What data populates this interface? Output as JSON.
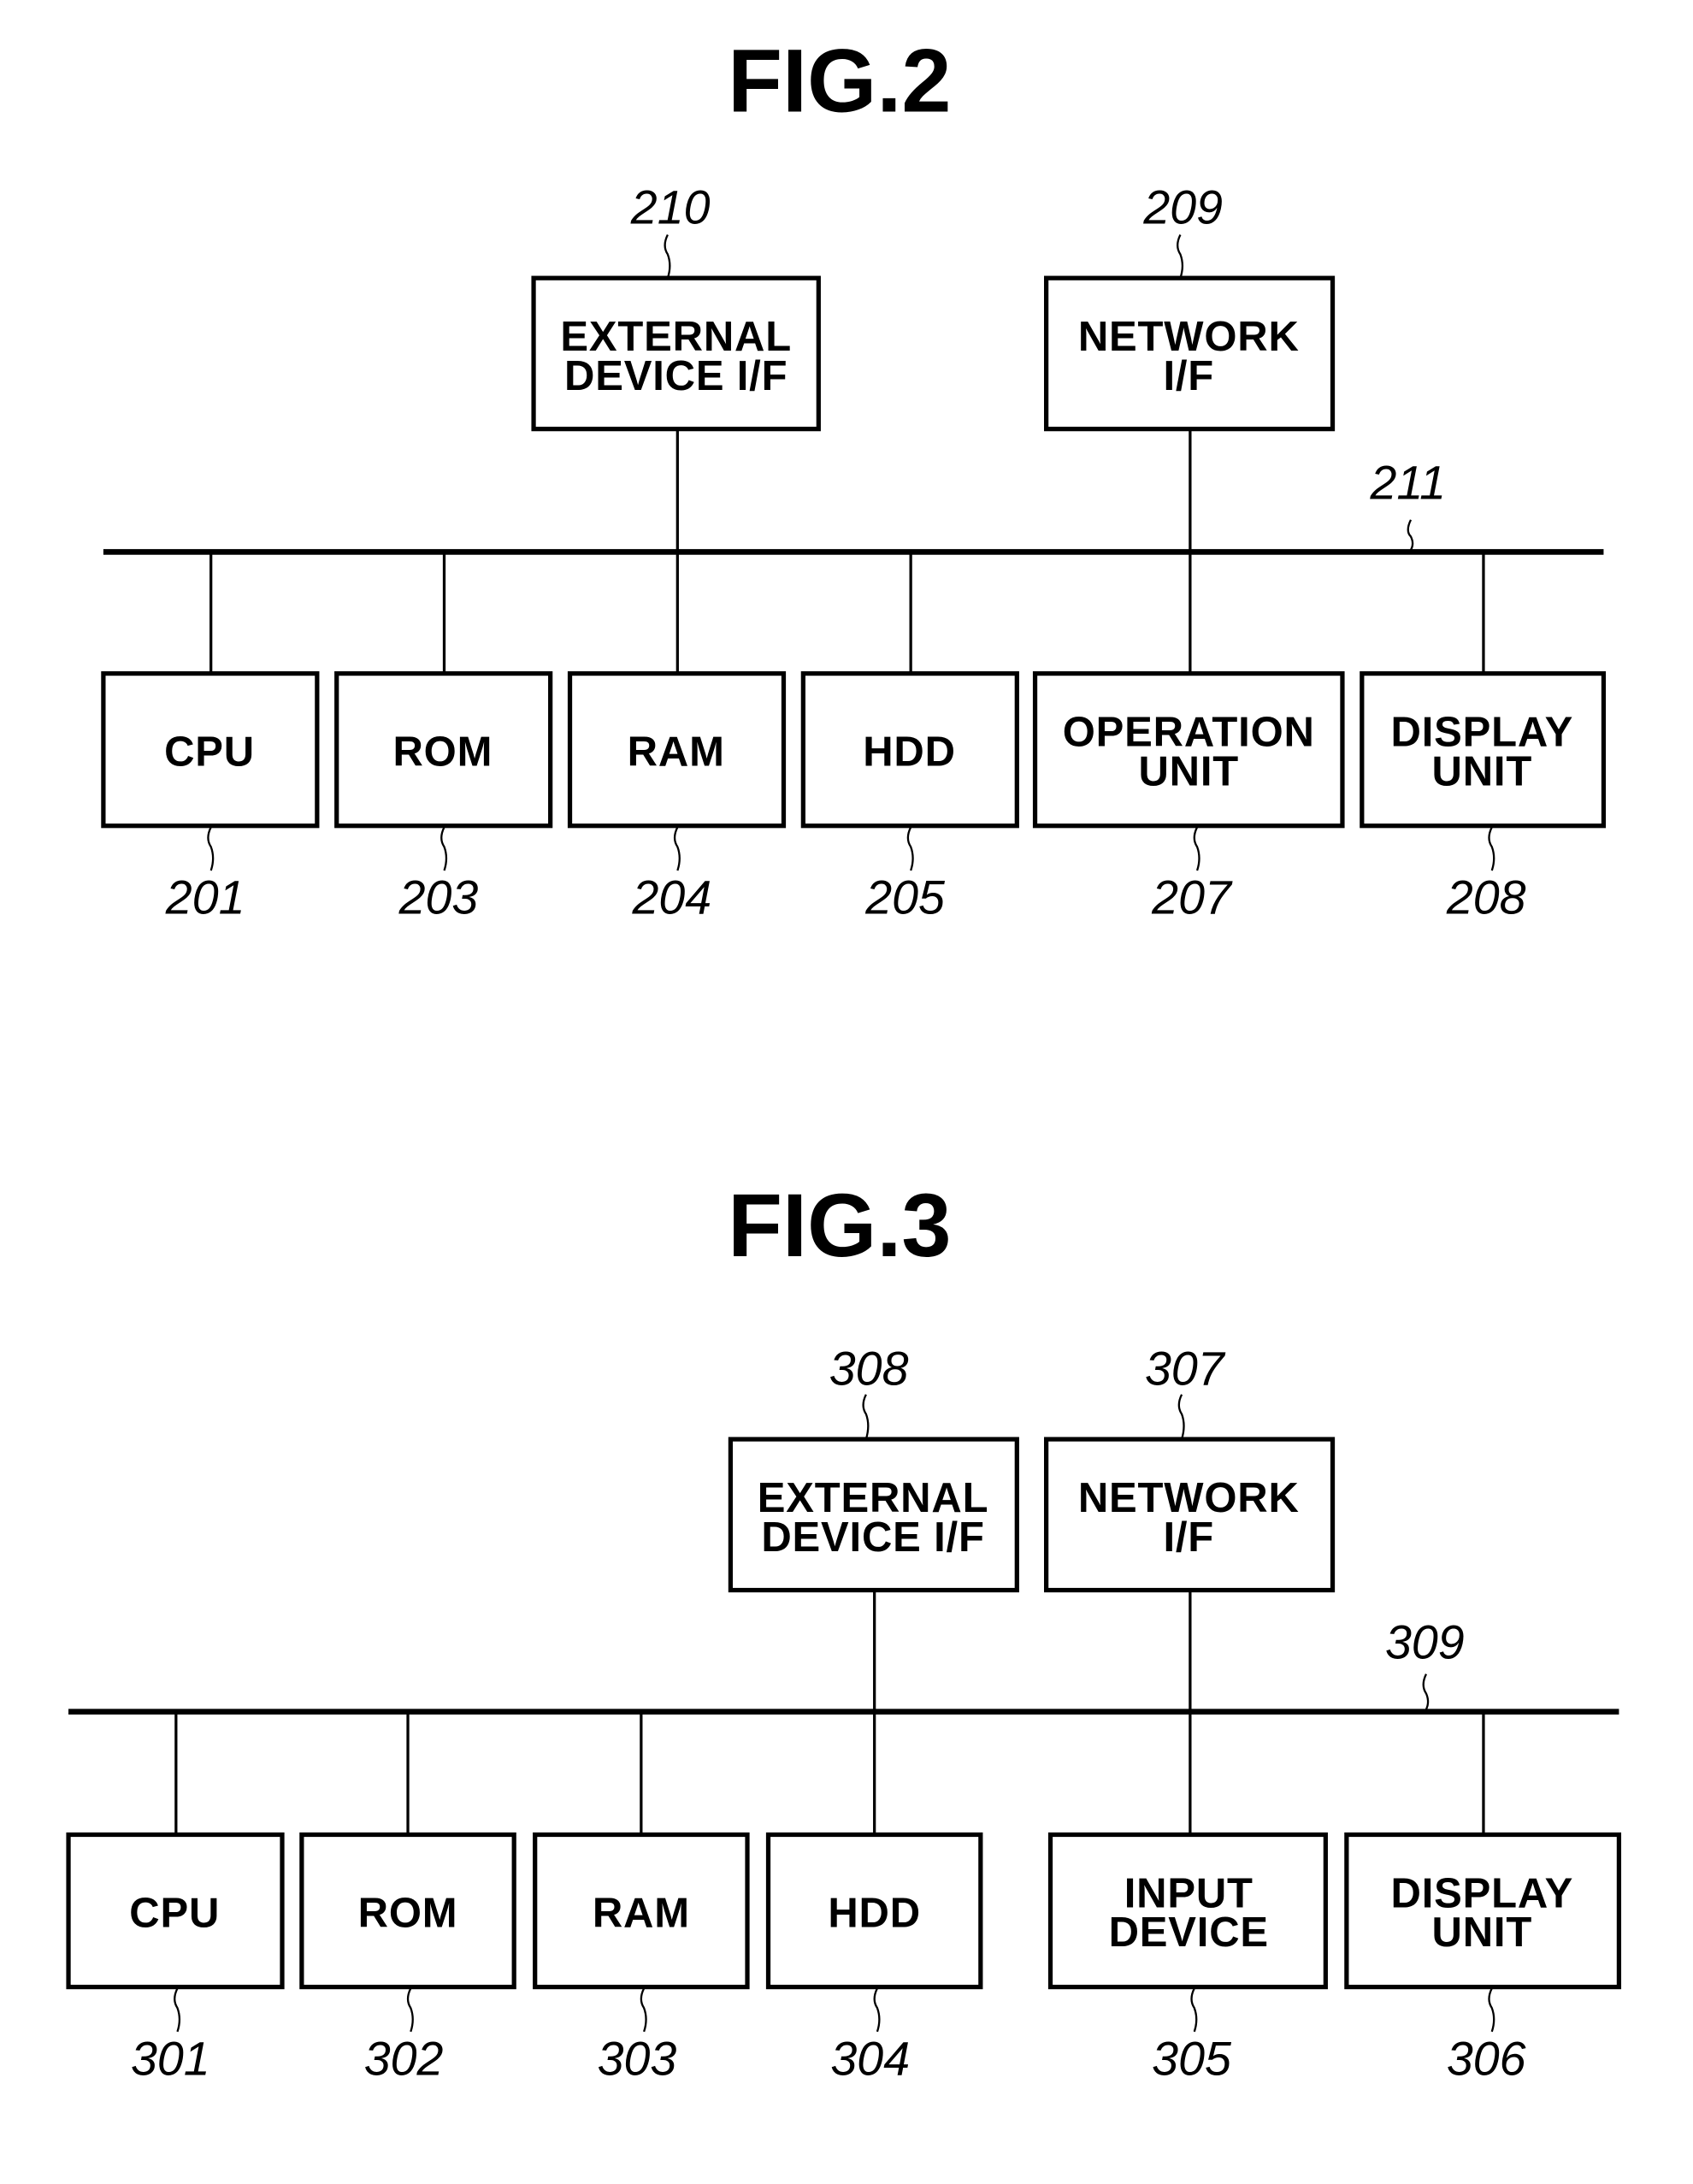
{
  "figures": [
    {
      "title": "FIG.2",
      "bus_ref": "211",
      "top_blocks": [
        {
          "id": "external-device-if",
          "lines": [
            "EXTERNAL",
            "DEVICE I/F"
          ],
          "ref": "210"
        },
        {
          "id": "network-if",
          "lines": [
            "NETWORK",
            "I/F"
          ],
          "ref": "209"
        }
      ],
      "bottom_blocks": [
        {
          "id": "cpu",
          "lines": [
            "CPU"
          ],
          "ref": "201"
        },
        {
          "id": "rom",
          "lines": [
            "ROM"
          ],
          "ref": "203"
        },
        {
          "id": "ram",
          "lines": [
            "RAM"
          ],
          "ref": "204"
        },
        {
          "id": "hdd",
          "lines": [
            "HDD"
          ],
          "ref": "205"
        },
        {
          "id": "operation-unit",
          "lines": [
            "OPERATION",
            "UNIT"
          ],
          "ref": "207"
        },
        {
          "id": "display-unit",
          "lines": [
            "DISPLAY",
            "UNIT"
          ],
          "ref": "208"
        }
      ]
    },
    {
      "title": "FIG.3",
      "bus_ref": "309",
      "top_blocks": [
        {
          "id": "external-device-if",
          "lines": [
            "EXTERNAL",
            "DEVICE I/F"
          ],
          "ref": "308"
        },
        {
          "id": "network-if",
          "lines": [
            "NETWORK",
            "I/F"
          ],
          "ref": "307"
        }
      ],
      "bottom_blocks": [
        {
          "id": "cpu",
          "lines": [
            "CPU"
          ],
          "ref": "301"
        },
        {
          "id": "rom",
          "lines": [
            "ROM"
          ],
          "ref": "302"
        },
        {
          "id": "ram",
          "lines": [
            "RAM"
          ],
          "ref": "303"
        },
        {
          "id": "hdd",
          "lines": [
            "HDD"
          ],
          "ref": "304"
        },
        {
          "id": "input-device",
          "lines": [
            "INPUT",
            "DEVICE"
          ],
          "ref": "305"
        },
        {
          "id": "display-unit",
          "lines": [
            "DISPLAY",
            "UNIT"
          ],
          "ref": "306"
        }
      ]
    }
  ]
}
